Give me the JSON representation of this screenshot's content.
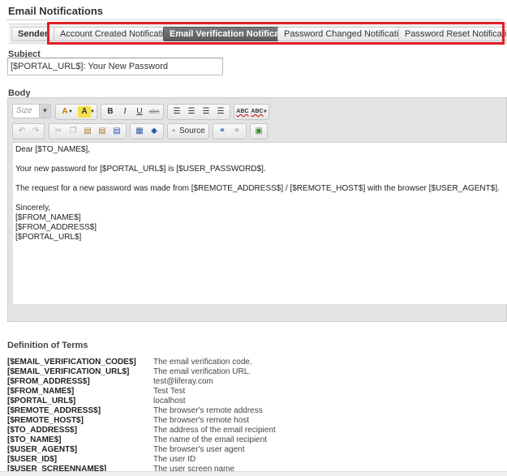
{
  "section": {
    "title": "Email Notifications"
  },
  "tabs": [
    {
      "label": "Sender",
      "active": false
    },
    {
      "label": "Account Created Notification",
      "active": false
    },
    {
      "label": "Email Verification Notification",
      "active": true
    },
    {
      "label": "Password Changed Notification",
      "active": false
    },
    {
      "label": "Password Reset Notification",
      "active": false
    }
  ],
  "highlight_color": "#e21e26",
  "subject": {
    "label": "Subject",
    "value": "[$PORTAL_URL$]: Your New Password"
  },
  "body": {
    "label": "Body",
    "toolbar": {
      "size_placeholder": "Size",
      "source_label": "Source",
      "icons": [
        "text-color-icon",
        "background-color-icon",
        "bold-icon",
        "italic-icon",
        "underline-icon",
        "strikethrough-icon",
        "align-left-icon",
        "align-center-icon",
        "align-right-icon",
        "justify-icon",
        "spellcheck-icon",
        "spellcheck-as-you-type-icon",
        "undo-icon",
        "redo-icon",
        "cut-icon",
        "copy-icon",
        "paste-icon",
        "paste-text-icon",
        "paste-word-icon",
        "table-icon",
        "remove-format-icon",
        "source-icon",
        "link-icon",
        "unlink-icon",
        "image-icon"
      ],
      "glyphs": {
        "text_color": "A",
        "bg_color": "A",
        "bold": "B",
        "italic": "I",
        "underline": "U",
        "strike": "abc",
        "spell1": "ABC",
        "spell2": "ABC"
      }
    },
    "content_lines": [
      "Dear [$TO_NAME$],",
      "",
      "Your new password for [$PORTAL_URL$] is [$USER_PASSWORD$].",
      "",
      "The request for a new password was made from [$REMOTE_ADDRESS$] / [$REMOTE_HOST$] with the browser [$USER_AGENT$].",
      "",
      "Sincerely,",
      "[$FROM_NAME$]",
      "[$FROM_ADDRESS$]",
      "[$PORTAL_URL$]"
    ]
  },
  "definitions": {
    "title": "Definition of Terms",
    "rows": [
      {
        "term": "[$EMAIL_VERIFICATION_CODE$]",
        "desc": "The email verification code."
      },
      {
        "term": "[$EMAIL_VERIFICATION_URL$]",
        "desc": "The email verification URL."
      },
      {
        "term": "[$FROM_ADDRESS$]",
        "desc": "test@liferay.com"
      },
      {
        "term": "[$FROM_NAME$]",
        "desc": "Test Test"
      },
      {
        "term": "[$PORTAL_URL$]",
        "desc": "localhost"
      },
      {
        "term": "[$REMOTE_ADDRESS$]",
        "desc": "The browser's remote address"
      },
      {
        "term": "[$REMOTE_HOST$]",
        "desc": "The browser's remote host"
      },
      {
        "term": "[$TO_ADDRESS$]",
        "desc": "The address of the email recipient"
      },
      {
        "term": "[$TO_NAME$]",
        "desc": "The name of the email recipient"
      },
      {
        "term": "[$USER_AGENT$]",
        "desc": "The browser's user agent"
      },
      {
        "term": "[$USER_ID$]",
        "desc": "The user ID"
      },
      {
        "term": "[$USER_SCREENNAME$]",
        "desc": "The user screen name"
      }
    ]
  }
}
